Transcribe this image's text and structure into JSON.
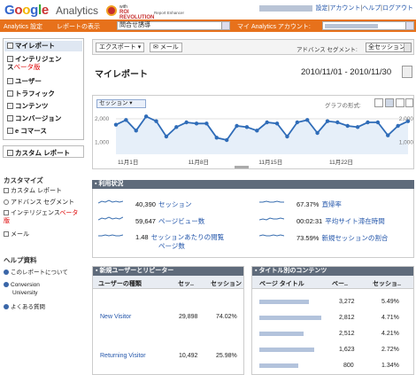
{
  "header": {
    "logo_google": "Google",
    "logo_analytics": "Analytics",
    "roi_with": "with",
    "roi_brand_1": "ROI",
    "roi_brand_2": "REVOLUTION",
    "roi_sub": "Report Enhancer",
    "links": [
      "設定",
      "アカウント",
      "ヘルプ",
      "ログアウト"
    ]
  },
  "navbar": {
    "settings": "Analytics 設定",
    "report_view": "レポートの表示",
    "report_select": "問合せ誘導",
    "my_account": "マイ Analytics アカウント:"
  },
  "sidebar": {
    "reports": [
      {
        "label": "マイレポート",
        "icon": "my-report-icon"
      },
      {
        "label": "インテリジェン",
        "label2": "ス",
        "beta": "ベータ版",
        "icon": "intelligence-icon"
      },
      {
        "label": "ユーザー",
        "icon": "users-icon"
      },
      {
        "label": "トラフィック",
        "icon": "traffic-icon"
      },
      {
        "label": "コンテンツ",
        "icon": "content-icon"
      },
      {
        "label": "コンバージョン",
        "icon": "conversion-icon"
      },
      {
        "label": "e コマース",
        "icon": "ecommerce-icon"
      }
    ],
    "custom_reports": "カスタム レポート",
    "customize_title": "カスタマイズ",
    "customize_items": [
      "カスタム レポート",
      "アドバンス セグメント",
      "インテリジェンス",
      "メール"
    ],
    "customize_beta": "ベータ",
    "customize_beta2": "版",
    "help_title": "ヘルプ資料",
    "help_items": [
      "このレポートについて",
      "Conversion",
      "University",
      "よくある質問"
    ]
  },
  "toolbar": {
    "export": "エクスポート",
    "email": "メール",
    "segment_label": "アドバンス セグメント:",
    "segment_value": "全セッション"
  },
  "page": {
    "title": "マイレポート",
    "date_range": "2010/11/01 - 2010/11/30"
  },
  "chart": {
    "metric_select": "セッション",
    "graph_mode_label": "グラフの形式:"
  },
  "chart_data": {
    "type": "line",
    "ylim": [
      500,
      2300
    ],
    "ytick_labels": [
      "2,000",
      "1,000",
      "2,000",
      "1,000"
    ],
    "xtick_labels": [
      "11月1日",
      "11月8日",
      "11月15日",
      "11月22日"
    ],
    "series": [
      {
        "values": [
          1750,
          1950,
          1500,
          2100,
          1900,
          1250,
          1650,
          1850,
          1800,
          1800,
          1200,
          1100,
          1700,
          1650,
          1500,
          1850,
          1800,
          1250,
          1850,
          1950,
          1400,
          1900,
          1850,
          1700,
          1650,
          1850,
          1850,
          1300,
          1700,
          1900
        ]
      }
    ]
  },
  "summary": {
    "title": "利用状況",
    "stats": [
      {
        "value": "40,390",
        "label": "セッション"
      },
      {
        "value": "67.37%",
        "label": "直帰率"
      },
      {
        "value": "59,647",
        "label": "ページビュー数"
      },
      {
        "value": "00:02:31",
        "label": "平均サイト滞在時間"
      },
      {
        "value": "1.48",
        "label": "セッションあたりの閲覧",
        "label2": "ページ数"
      },
      {
        "value": "73.59%",
        "label": "新規セッションの割合"
      }
    ]
  },
  "visitors_table": {
    "title": "新規ユーザーとリピーター",
    "columns": [
      "ユーザーの種類",
      "セッ..",
      "セッション"
    ],
    "rows": [
      {
        "type": "New Visitor",
        "sessions": "29,898",
        "pct": "74.02%"
      },
      {
        "type": "Returning Visitor",
        "sessions": "10,492",
        "pct": "25.98%"
      }
    ]
  },
  "content_table": {
    "title": "タイトル別のコンテンツ",
    "columns": [
      "ページ タイトル",
      "ペー..",
      "セッショ.."
    ],
    "rows": [
      {
        "pv": "3,272",
        "pct": "5.49%"
      },
      {
        "pv": "2,812",
        "pct": "4.71%"
      },
      {
        "pv": "2,512",
        "pct": "4.21%"
      },
      {
        "pv": "1,623",
        "pct": "2.72%"
      },
      {
        "pv": "800",
        "pct": "1.34%"
      }
    ]
  }
}
